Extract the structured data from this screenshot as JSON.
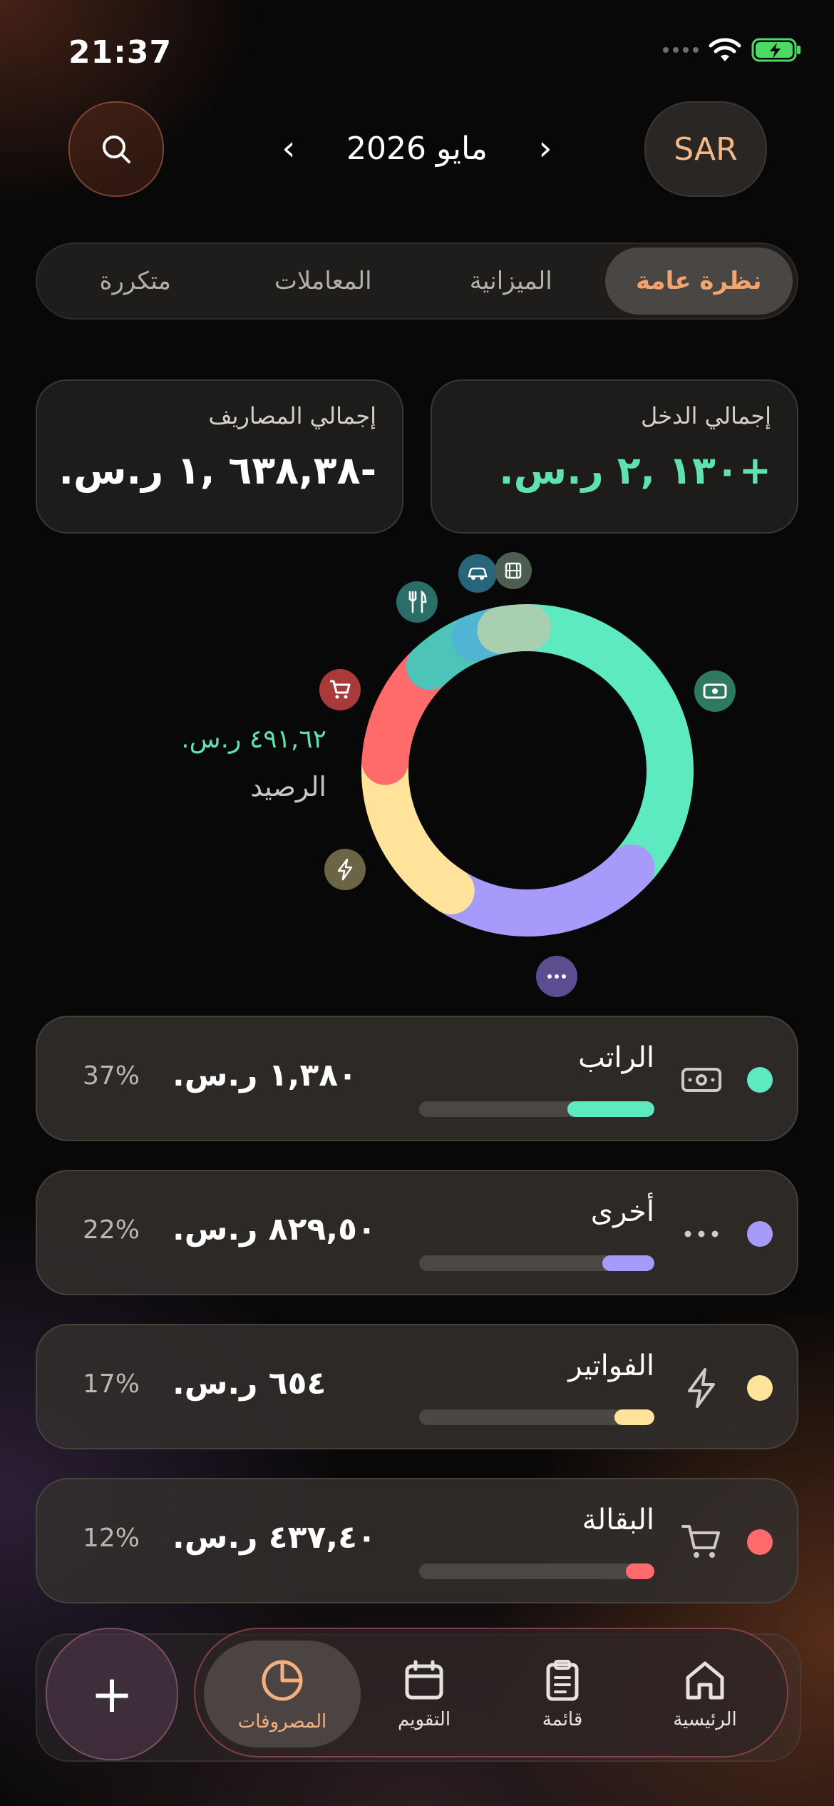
{
  "status_bar": {
    "time": "21:37"
  },
  "header": {
    "month": "مايو 2026",
    "currency": "SAR",
    "prev_icon": "chevron-left-icon",
    "next_icon": "chevron-right-icon",
    "search_icon": "search-icon"
  },
  "tabs": [
    {
      "label": "نظرة عامة",
      "active": true
    },
    {
      "label": "الميزانية",
      "active": false
    },
    {
      "label": "المعاملات",
      "active": false
    },
    {
      "label": "متكررة",
      "active": false
    }
  ],
  "summary": {
    "income_label": "إجمالي الدخل",
    "income_value": "+١٣٠ ,٢ ر.س.",
    "expense_label": "إجمالي المصاريف",
    "expense_value": "-٦٣٨,٣٨ ,١ ر.س."
  },
  "balance": {
    "amount": "٤٩١,٦٢ ر.س.",
    "label": "الرصيد"
  },
  "chart_data": {
    "type": "pie",
    "variant": "donut",
    "segments": [
      {
        "name": "الراتب",
        "percent": 37,
        "color": "#5eeac1",
        "icon": "cash-icon"
      },
      {
        "name": "أخرى",
        "percent": 22,
        "color": "#a69afb",
        "icon": "more-icon"
      },
      {
        "name": "الفواتير",
        "percent": 17,
        "color": "#ffe39a",
        "icon": "lightning-icon"
      },
      {
        "name": "البقالة",
        "percent": 12,
        "color": "#ff6b6b",
        "icon": "cart-icon"
      },
      {
        "name": "مطاعم",
        "percent": 6,
        "color": "#4cc5b8",
        "icon": "fork-knife-icon"
      },
      {
        "name": "نقل",
        "percent": 3,
        "color": "#52b4d3",
        "icon": "car-icon"
      },
      {
        "name": "ترفيه",
        "percent": 3,
        "color": "#a8cfb0",
        "icon": "film-icon"
      }
    ]
  },
  "categories": [
    {
      "name": "الراتب",
      "amount": "١,٣٨٠ ر.س.",
      "percent": "37%",
      "fill": 0.37,
      "color": "#5eeac1",
      "icon": "cash-icon"
    },
    {
      "name": "أخرى",
      "amount": "٨٢٩,٥٠ ر.س.",
      "percent": "22%",
      "fill": 0.22,
      "color": "#a69afb",
      "icon": "more-icon"
    },
    {
      "name": "الفواتير",
      "amount": "٦٥٤ ر.س.",
      "percent": "17%",
      "fill": 0.17,
      "color": "#ffe39a",
      "icon": "lightning-icon"
    },
    {
      "name": "البقالة",
      "amount": "٤٣٧,٤٠ ر.س.",
      "percent": "12%",
      "fill": 0.12,
      "color": "#ff6b6b",
      "icon": "cart-icon"
    }
  ],
  "bottom_nav": [
    {
      "label": "الرئيسية",
      "icon": "home-icon",
      "active": false
    },
    {
      "label": "قائمة",
      "icon": "clipboard-list-icon",
      "active": false
    },
    {
      "label": "التقويم",
      "icon": "calendar-icon",
      "active": false
    },
    {
      "label": "المصروفات",
      "icon": "pie-chart-icon",
      "active": true
    }
  ],
  "add_button": {
    "icon": "plus-icon",
    "label": "+"
  }
}
